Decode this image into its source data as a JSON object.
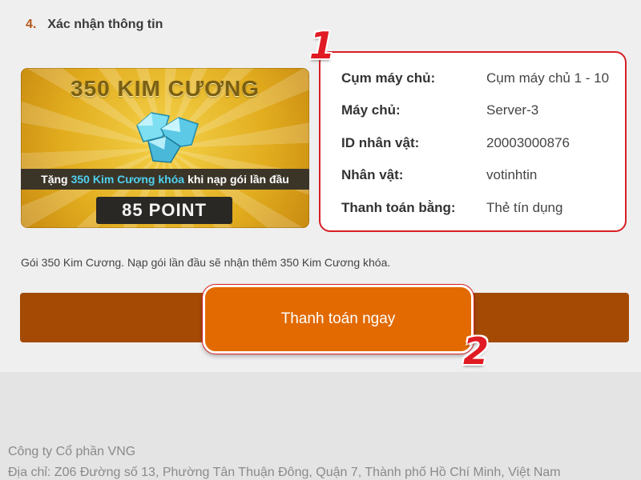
{
  "step": {
    "number": "4.",
    "title": "Xác nhận thông tin"
  },
  "package_banner": {
    "title": "350 KIM CƯƠNG",
    "strip_prefix": "Tặng",
    "strip_highlight": "350 Kim Cương khóa",
    "strip_suffix": "khi nạp gói lần đầu",
    "points": "85 POINT",
    "icon": "diamond-icon"
  },
  "info_card": {
    "rows": [
      {
        "label": "Cụm máy chủ:",
        "value": "Cụm máy chủ 1 - 10"
      },
      {
        "label": "Máy chủ:",
        "value": "Server-3"
      },
      {
        "label": "ID nhân vật:",
        "value": "20003000876"
      },
      {
        "label": "Nhân vật:",
        "value": "votinhtin"
      },
      {
        "label": "Thanh toán bằng:",
        "value": "Thẻ tín dụng"
      }
    ]
  },
  "markers": {
    "one": "1",
    "two": "2"
  },
  "description": "Gói 350 Kim Cương. Nạp gói lần đầu sẽ nhận thêm 350 Kim Cương khóa.",
  "pay_button_label": "Thanh toán ngay",
  "footer": {
    "company": "Công ty Cổ phần VNG",
    "address": "Địa chỉ: Z06 Đường số 13, Phường Tân Thuận Đông, Quận 7, Thành phố Hồ Chí Minh, Việt Nam"
  },
  "colors": {
    "accent_orange": "#e26a00",
    "pay_bar": "#a44a05",
    "highlight_red": "#d81f26"
  }
}
